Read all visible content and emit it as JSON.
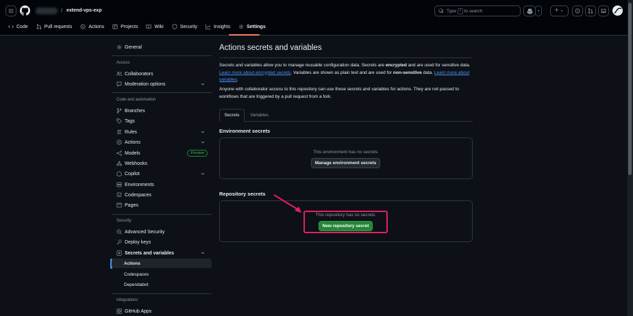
{
  "header": {
    "repo_name": "extend-vps-exp",
    "separator": "/",
    "search_prefix": "Type",
    "search_key": "/",
    "search_suffix": "to search",
    "plus_label": "+"
  },
  "nav_tabs": [
    {
      "label": "Code",
      "icon": "code-icon"
    },
    {
      "label": "Pull requests",
      "icon": "pull-request-icon"
    },
    {
      "label": "Actions",
      "icon": "actions-icon"
    },
    {
      "label": "Projects",
      "icon": "projects-icon"
    },
    {
      "label": "Wiki",
      "icon": "book-icon"
    },
    {
      "label": "Security",
      "icon": "shield-icon"
    },
    {
      "label": "Insights",
      "icon": "graph-icon"
    },
    {
      "label": "Settings",
      "icon": "gear-icon",
      "selected": true
    }
  ],
  "sidebar": {
    "general": "General",
    "access_heading": "Access",
    "collaborators": "Collaborators",
    "moderation": "Moderation options",
    "code_heading": "Code and automation",
    "branches": "Branches",
    "tags": "Tags",
    "rules": "Rules",
    "actions": "Actions",
    "models": "Models",
    "models_badge": "Preview",
    "webhooks": "Webhooks",
    "copilot": "Copilot",
    "environments": "Environments",
    "codespaces": "Codespaces",
    "pages": "Pages",
    "security_heading": "Security",
    "advanced_security": "Advanced Security",
    "deploy_keys": "Deploy keys",
    "secrets_vars": "Secrets and variables",
    "sub_actions": "Actions",
    "sub_codespaces": "Codespaces",
    "sub_dependabot": "Dependabot",
    "integrations_heading": "Integrations",
    "github_apps": "GitHub Apps"
  },
  "main": {
    "title": "Actions secrets and variables",
    "desc1_a": "Secrets and variables allow you to manage reusable configuration data. Secrets are ",
    "desc1_b": "encrypted",
    "desc1_c": " and are used for sensitive data. ",
    "desc1_link1": "Learn more about encrypted secrets",
    "desc1_d": ". Variables are shown as plain text and are used for ",
    "desc1_e": "non-sensitive",
    "desc1_f": " data. ",
    "desc1_link2": "Learn more about variables",
    "desc1_g": ".",
    "desc2": "Anyone with collaborator access to this repository can use these secrets and variables for actions. They are not passed to workflows that are triggered by a pull request from a fork.",
    "tab_secrets": "Secrets",
    "tab_variables": "Variables",
    "env_heading": "Environment secrets",
    "env_empty": "This environment has no secrets.",
    "env_button": "Manage environment secrets",
    "repo_heading": "Repository secrets",
    "repo_empty": "This repository has no secrets.",
    "repo_button": "New repository secret"
  },
  "colors": {
    "background": "#0d1117",
    "header": "#010409",
    "accent_link": "#4493f8",
    "primary_button": "#238636",
    "annotation": "#e91e63",
    "tab_underline": "#f78166"
  }
}
